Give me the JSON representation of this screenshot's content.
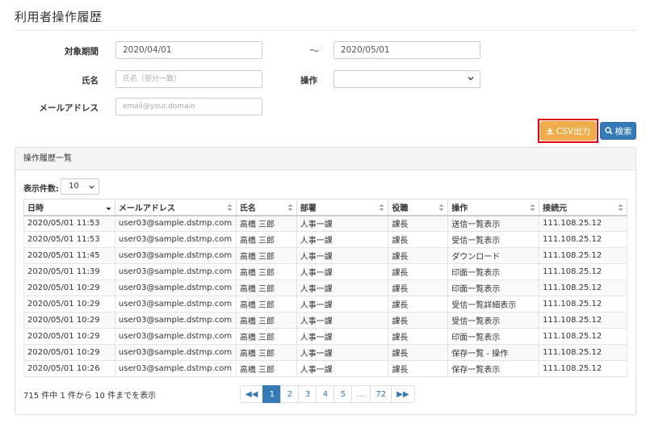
{
  "page": {
    "title": "利用者操作履歴"
  },
  "filters": {
    "period_label": "対象期間",
    "date_from": "2020/04/01",
    "tilde": "～",
    "date_to": "2020/05/01",
    "name_label": "氏名",
    "name_placeholder": "氏名（部分一致）",
    "operation_label": "操作",
    "operation_value": "",
    "email_label": "メールアドレス",
    "email_placeholder": "email@your.domain"
  },
  "actions": {
    "csv_label": "CSV出力",
    "search_label": "検索",
    "csv_color": "#f0ad4e",
    "search_color": "#337ab7",
    "highlight_color": "#e60012"
  },
  "panel": {
    "heading": "操作履歴一覧",
    "page_size_label": "表示件数:",
    "page_size_value": "10"
  },
  "table": {
    "columns": [
      "日時",
      "メールアドレス",
      "氏名",
      "部署",
      "役職",
      "操作",
      "接続元"
    ],
    "rows": [
      [
        "2020/05/01 11:53",
        "user03@sample.dstmp.com",
        "高橋 三郎",
        "人事一課",
        "課長",
        "送信一覧表示",
        "111.108.25.12"
      ],
      [
        "2020/05/01 11:53",
        "user03@sample.dstmp.com",
        "高橋 三郎",
        "人事一課",
        "課長",
        "受信一覧表示",
        "111.108.25.12"
      ],
      [
        "2020/05/01 11:45",
        "user03@sample.dstmp.com",
        "高橋 三郎",
        "人事一課",
        "課長",
        "ダウンロード",
        "111.108.25.12"
      ],
      [
        "2020/05/01 11:39",
        "user03@sample.dstmp.com",
        "高橋 三郎",
        "人事一課",
        "課長",
        "印面一覧表示",
        "111.108.25.12"
      ],
      [
        "2020/05/01 10:29",
        "user03@sample.dstmp.com",
        "高橋 三郎",
        "人事一課",
        "課長",
        "印面一覧表示",
        "111.108.25.12"
      ],
      [
        "2020/05/01 10:29",
        "user03@sample.dstmp.com",
        "高橋 三郎",
        "人事一課",
        "課長",
        "受信一覧詳細表示",
        "111.108.25.12"
      ],
      [
        "2020/05/01 10:29",
        "user03@sample.dstmp.com",
        "高橋 三郎",
        "人事一課",
        "課長",
        "受信一覧表示",
        "111.108.25.12"
      ],
      [
        "2020/05/01 10:29",
        "user03@sample.dstmp.com",
        "高橋 三郎",
        "人事一課",
        "課長",
        "印面一覧表示",
        "111.108.25.12"
      ],
      [
        "2020/05/01 10:29",
        "user03@sample.dstmp.com",
        "高橋 三郎",
        "人事一課",
        "課長",
        "保存一覧 - 操作",
        "111.108.25.12"
      ],
      [
        "2020/05/01 10:26",
        "user03@sample.dstmp.com",
        "高橋 三郎",
        "人事一課",
        "課長",
        "保存一覧表示",
        "111.108.25.12"
      ]
    ]
  },
  "pagination": {
    "summary": "715 件中 1 件から 10 件までを表示",
    "first": "◀◀",
    "pages": [
      "1",
      "2",
      "3",
      "4",
      "5",
      "…",
      "72"
    ],
    "last": "▶▶",
    "active": "1"
  }
}
